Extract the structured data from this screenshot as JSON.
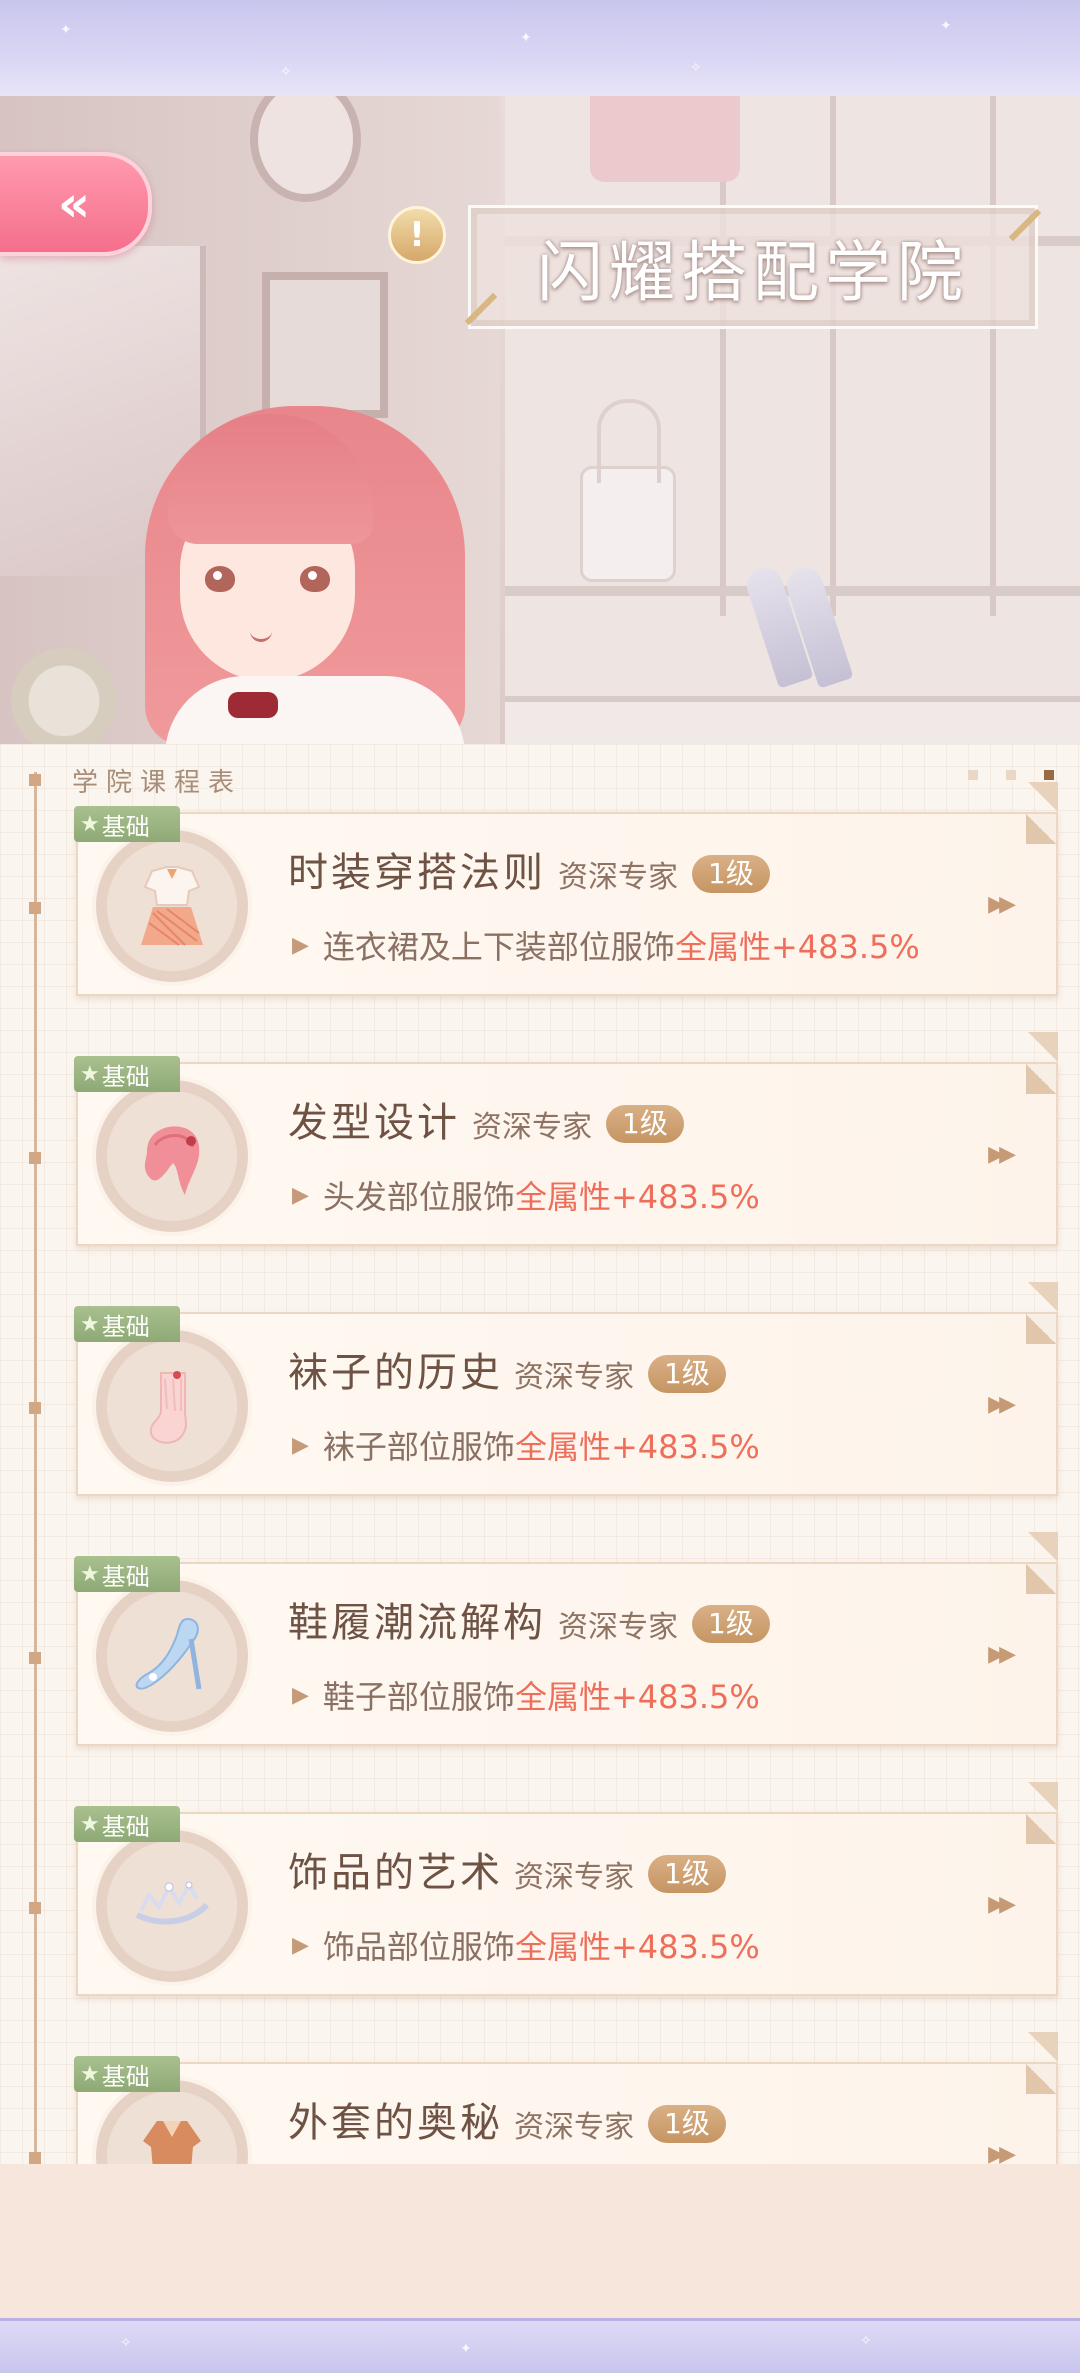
{
  "header": {
    "title": "闪耀搭配学院",
    "back_symbol": "«",
    "alert_symbol": "!"
  },
  "schedule": {
    "label": "学院课程表",
    "pages": 3,
    "current_page": 3
  },
  "courses": [
    {
      "tag": "基础",
      "title": "时装穿搭法则",
      "expert": "资深专家",
      "level": "1级",
      "effect_prefix": "连衣裙及上下装部位服饰",
      "effect_highlight": "全属性+483.5%",
      "icon": "outfit-icon"
    },
    {
      "tag": "基础",
      "title": "发型设计",
      "expert": "资深专家",
      "level": "1级",
      "effect_prefix": "头发部位服饰",
      "effect_highlight": "全属性+483.5%",
      "icon": "hair-icon"
    },
    {
      "tag": "基础",
      "title": "袜子的历史",
      "expert": "资深专家",
      "level": "1级",
      "effect_prefix": "袜子部位服饰",
      "effect_highlight": "全属性+483.5%",
      "icon": "sock-icon"
    },
    {
      "tag": "基础",
      "title": "鞋履潮流解构",
      "expert": "资深专家",
      "level": "1级",
      "effect_prefix": "鞋子部位服饰",
      "effect_highlight": "全属性+483.5%",
      "icon": "shoe-icon"
    },
    {
      "tag": "基础",
      "title": "饰品的艺术",
      "expert": "资深专家",
      "level": "1级",
      "effect_prefix": "饰品部位服饰",
      "effect_highlight": "全属性+483.5%",
      "icon": "tiara-icon"
    },
    {
      "tag": "基础",
      "title": "外套的奥秘",
      "expert": "资深专家",
      "level": "1级",
      "effect_prefix": "",
      "effect_highlight": "",
      "icon": "coat-icon"
    }
  ],
  "colors": {
    "accent_pink": "#f56f8c",
    "tag_green": "#8ea976",
    "level_gold": "#c69563",
    "highlight_red": "#ee6e5a"
  }
}
